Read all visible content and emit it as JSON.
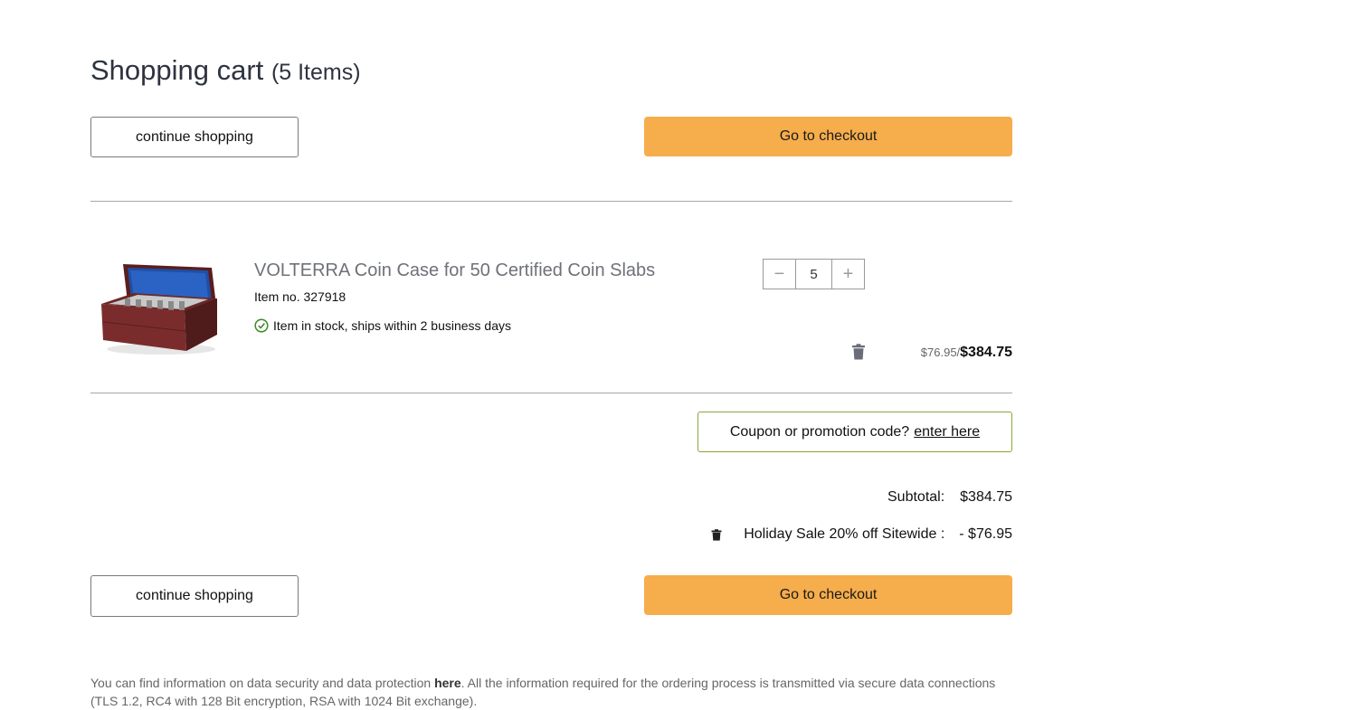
{
  "header": {
    "title": "Shopping cart",
    "item_count": "(5 Items)"
  },
  "actions": {
    "continue_label": "continue shopping",
    "checkout_label": "Go to checkout"
  },
  "cart_item": {
    "name": "VOLTERRA Coin Case for 50 Certified Coin Slabs",
    "item_no": "Item no. 327918",
    "stock": "Item in stock, ships within 2 business days",
    "quantity": "5",
    "unit_price": "$76.95/",
    "total_price": "$384.75"
  },
  "coupon": {
    "prompt": "Coupon or promotion code?",
    "link": "enter here"
  },
  "summary": {
    "subtotal_label": "Subtotal:",
    "subtotal_value": "$384.75",
    "discount_label": "Holiday Sale 20% off Sitewide :",
    "discount_value": "- $76.95"
  },
  "footer": {
    "text_before": "You can find information on data security and data protection ",
    "link": "here",
    "text_after": ". All the information required for the ordering process is transmitted via secure data connections (TLS 1.2, RC4 with 128 Bit encryption, RSA with 1024 Bit exchange)."
  },
  "colors": {
    "checkout": "#f6ad4c",
    "stock_ok": "#3d8a2b",
    "coupon_border": "#8aa63a"
  }
}
